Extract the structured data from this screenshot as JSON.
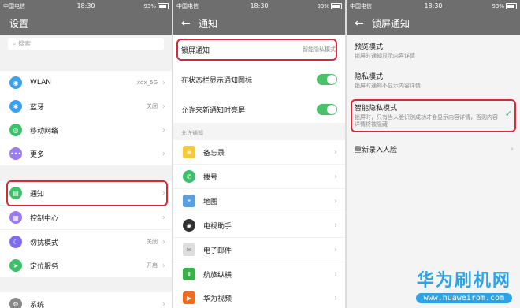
{
  "status_bar": {
    "carrier": "中国电信",
    "time": "18:30",
    "battery": "93%"
  },
  "panel1": {
    "title": "设置",
    "search_placeholder": "搜索",
    "items": [
      {
        "label": "WLAN",
        "value": "xqx_5G",
        "icon": "wifi-icon",
        "color": "#3aa0f0"
      },
      {
        "label": "蓝牙",
        "value": "关闭",
        "icon": "bluetooth-icon",
        "color": "#3aa0f0"
      },
      {
        "label": "移动网络",
        "value": "",
        "icon": "mobile-network-icon",
        "color": "#3cc06a"
      },
      {
        "label": "更多",
        "value": "",
        "icon": "more-icon",
        "color": "#9a7cf0"
      },
      {
        "label": "通知",
        "value": "",
        "icon": "notification-icon",
        "color": "#3cc06a"
      },
      {
        "label": "控制中心",
        "value": "",
        "icon": "control-center-icon",
        "color": "#9a7cf0"
      },
      {
        "label": "勿扰模式",
        "value": "关闭",
        "icon": "moon-icon",
        "color": "#7c6cf0"
      },
      {
        "label": "定位服务",
        "value": "开启",
        "icon": "location-icon",
        "color": "#3cc06a"
      },
      {
        "label": "系统",
        "value": "",
        "icon": "system-icon",
        "color": "#888888"
      }
    ]
  },
  "panel2": {
    "title": "通知",
    "lock_screen": {
      "label": "锁屏通知",
      "value": "智能隐私模式"
    },
    "toggles": [
      {
        "label": "在状态栏显示通知图标"
      },
      {
        "label": "允许来新通知时亮屏"
      }
    ],
    "section_label": "允许通知",
    "apps": [
      {
        "label": "备忘录",
        "icon": "memo-icon",
        "color": "#f5c842"
      },
      {
        "label": "拨号",
        "icon": "phone-icon",
        "color": "#3cc06a"
      },
      {
        "label": "地图",
        "icon": "map-icon",
        "color": "#5aa0e0"
      },
      {
        "label": "电视助手",
        "icon": "tv-assistant-icon",
        "color": "#333333"
      },
      {
        "label": "电子邮件",
        "icon": "email-icon",
        "color": "#dddddd"
      },
      {
        "label": "航旅纵横",
        "icon": "travel-icon",
        "color": "#3cb048"
      },
      {
        "label": "华为视频",
        "icon": "video-icon",
        "color": "#f06a20"
      }
    ]
  },
  "panel3": {
    "title": "锁屏通知",
    "modes": [
      {
        "title": "预览模式",
        "desc": "锁屏时通知显示内容详情"
      },
      {
        "title": "隐私模式",
        "desc": "锁屏时通知不显示内容详情"
      },
      {
        "title": "智能隐私模式",
        "desc": "锁屏时，只有当人脸识别成功才会显示内容详情，否则内容详情将被隐藏"
      }
    ],
    "reenroll": "重新录入人脸"
  },
  "watermark": {
    "line1": "华为刷机网",
    "line2": "www.huaweirom.com"
  },
  "colors": {
    "accent_red": "#d62a36",
    "toggle_green": "#4bc26a",
    "check_green": "#3bb35a",
    "header_gray": "#6e6e6e"
  }
}
